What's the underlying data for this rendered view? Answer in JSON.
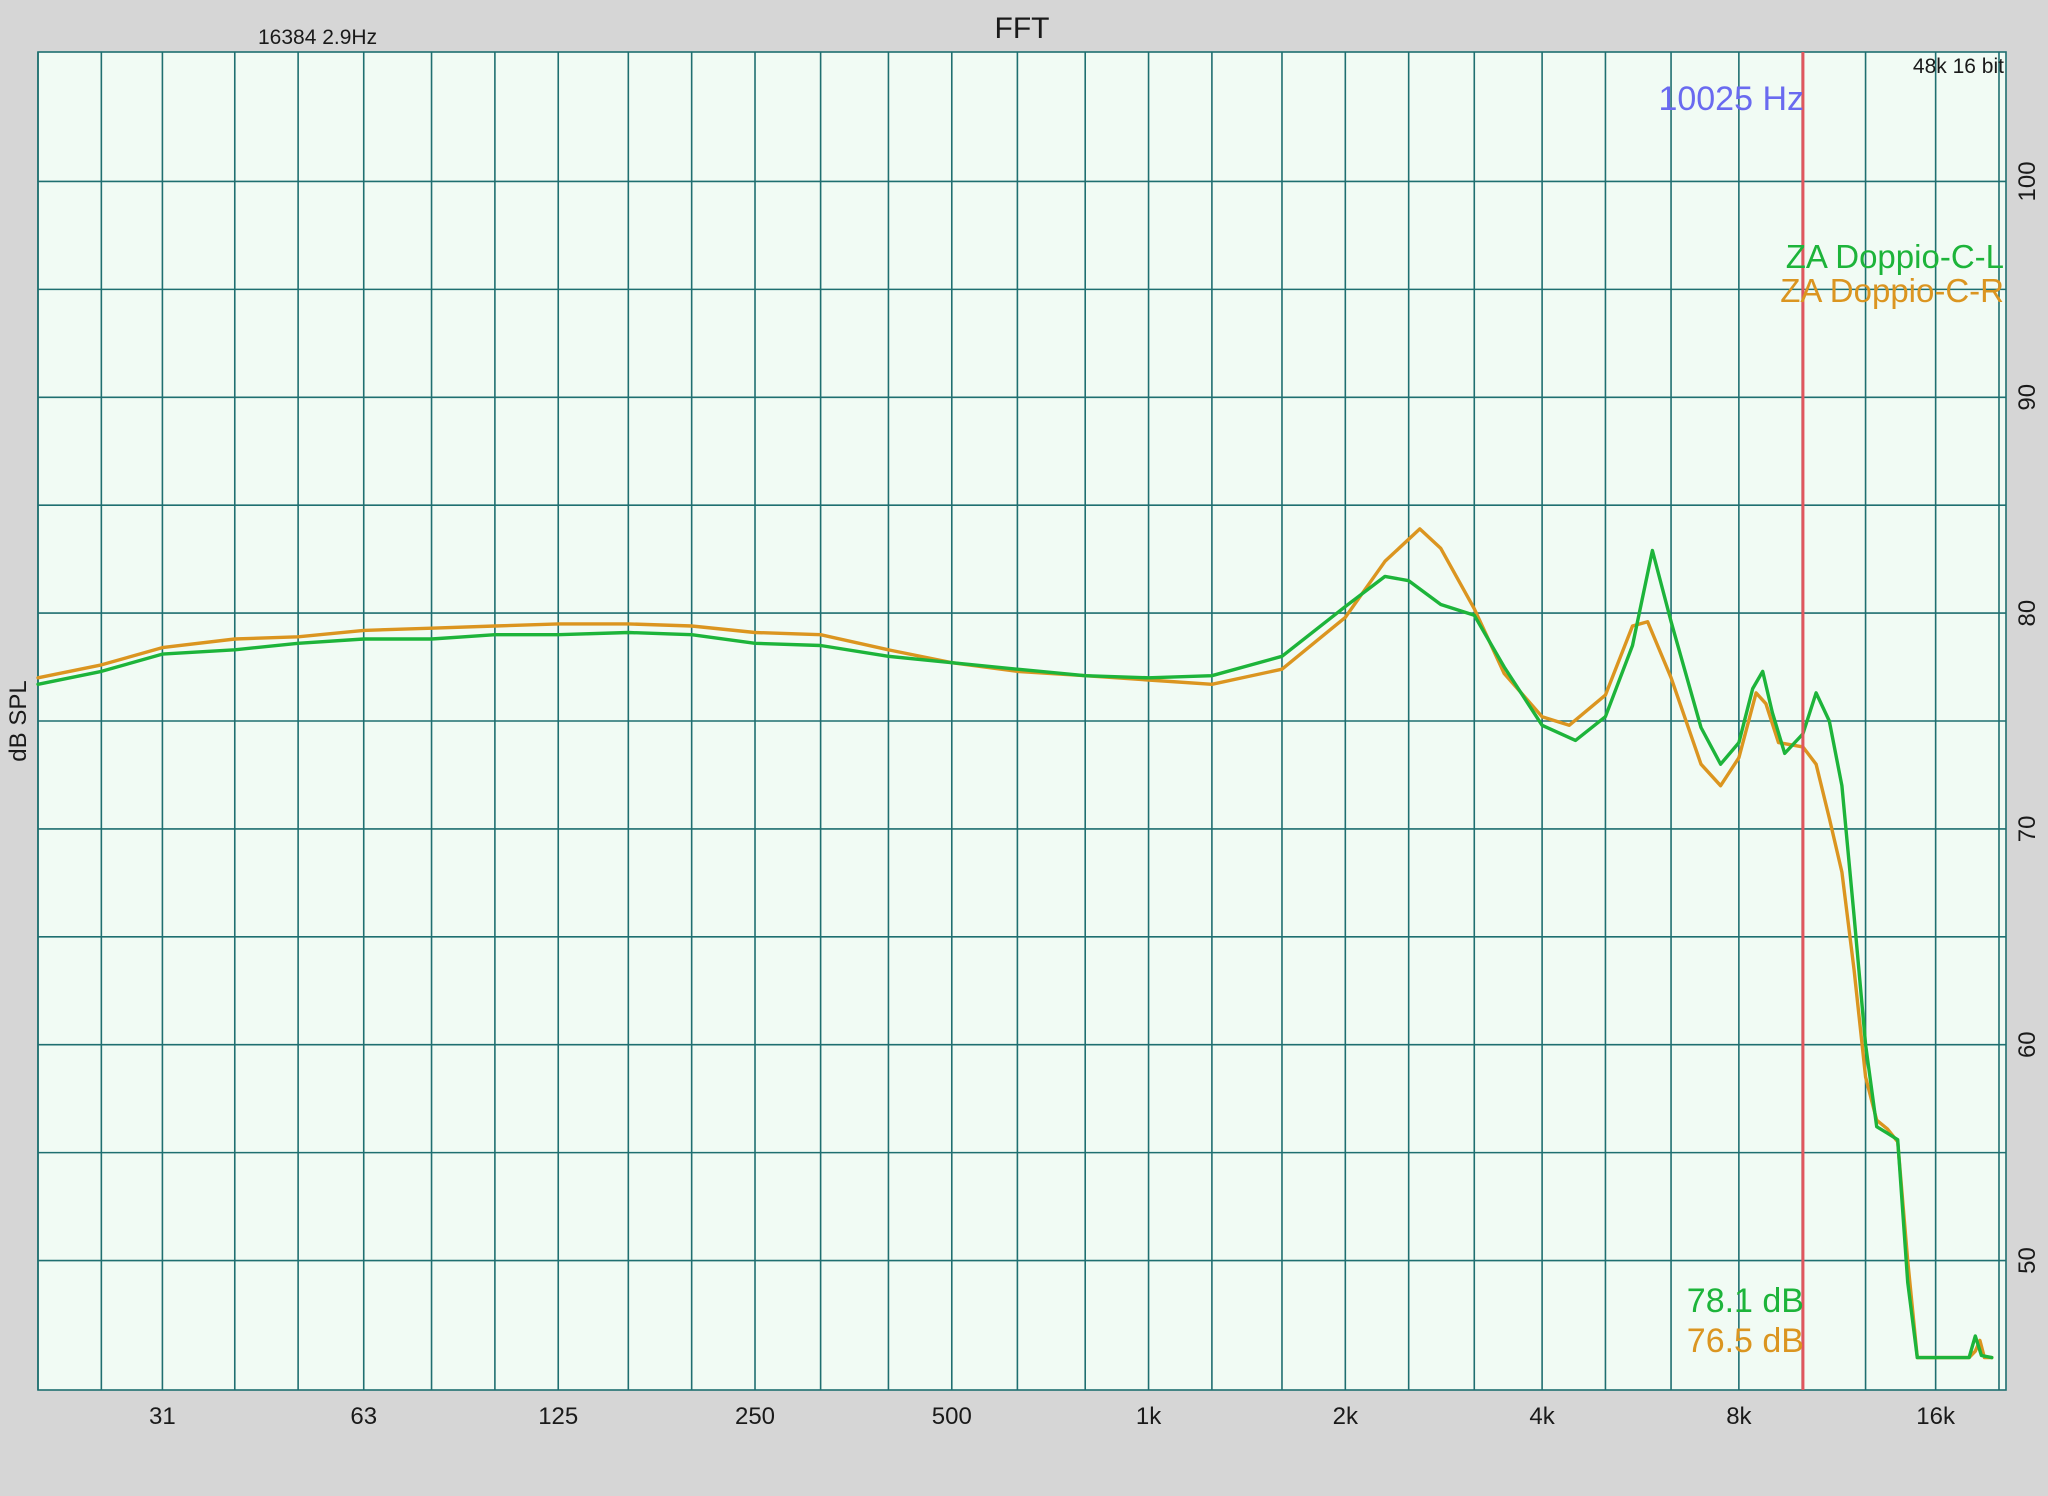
{
  "header": {
    "title": "FFT",
    "fft_info": "16384  2.9Hz",
    "format_info": "48k 16 bit"
  },
  "cursor": {
    "freq_label": "10025 Hz",
    "freq_hz": 10025,
    "readouts": [
      "78.1 dB",
      "76.5 dB"
    ]
  },
  "colors": {
    "plot_bg": "#f1fbf4",
    "frame_bg": "#d6d6d6",
    "grid": "#1f6f70",
    "cursor": "#e0565e",
    "cursor_label": "#6a6af0",
    "series_left": "#1db43a",
    "series_right": "#db9520"
  },
  "chart_data": {
    "type": "line",
    "title": "FFT",
    "xlabel": "",
    "ylabel": "dB SPL",
    "x_scale": "log",
    "xlim": [
      20,
      20500
    ],
    "ylim": [
      44,
      106
    ],
    "x_ticks": [
      {
        "value": 31,
        "label": "31"
      },
      {
        "value": 63,
        "label": "63"
      },
      {
        "value": 125,
        "label": "125"
      },
      {
        "value": 250,
        "label": "250"
      },
      {
        "value": 500,
        "label": "500"
      },
      {
        "value": 1000,
        "label": "1k"
      },
      {
        "value": 2000,
        "label": "2k"
      },
      {
        "value": 4000,
        "label": "4k"
      },
      {
        "value": 8000,
        "label": "8k"
      },
      {
        "value": 16000,
        "label": "16k"
      }
    ],
    "y_ticks": [
      {
        "value": 100,
        "label": "100"
      },
      {
        "value": 90,
        "label": "90"
      },
      {
        "value": 80,
        "label": "80"
      },
      {
        "value": 70,
        "label": "70"
      },
      {
        "value": 60,
        "label": "60"
      },
      {
        "value": 50,
        "label": "50"
      }
    ],
    "x_gridlines": [
      20,
      25,
      31,
      40,
      50,
      63,
      80,
      100,
      125,
      160,
      200,
      250,
      315,
      400,
      500,
      630,
      800,
      1000,
      1250,
      1600,
      2000,
      2500,
      3150,
      4000,
      5000,
      6300,
      8000,
      10000,
      12500,
      16000,
      20000
    ],
    "y_gridlines": [
      50,
      55,
      60,
      65,
      70,
      75,
      80,
      85,
      90,
      95,
      100
    ],
    "grid": true,
    "legend_position": "top-right",
    "series": [
      {
        "name": "ZA Doppio-C-L",
        "color": "#1db43a",
        "points": [
          [
            20,
            76.7
          ],
          [
            25,
            77.3
          ],
          [
            31,
            78.1
          ],
          [
            40,
            78.3
          ],
          [
            50,
            78.6
          ],
          [
            63,
            78.8
          ],
          [
            80,
            78.8
          ],
          [
            100,
            79.0
          ],
          [
            125,
            79.0
          ],
          [
            160,
            79.1
          ],
          [
            200,
            79.0
          ],
          [
            250,
            78.6
          ],
          [
            315,
            78.5
          ],
          [
            400,
            78.0
          ],
          [
            500,
            77.7
          ],
          [
            630,
            77.4
          ],
          [
            800,
            77.1
          ],
          [
            1000,
            77.0
          ],
          [
            1250,
            77.1
          ],
          [
            1600,
            78.0
          ],
          [
            2000,
            80.3
          ],
          [
            2300,
            81.7
          ],
          [
            2500,
            81.5
          ],
          [
            2800,
            80.4
          ],
          [
            3150,
            79.9
          ],
          [
            3500,
            77.5
          ],
          [
            4000,
            74.8
          ],
          [
            4500,
            74.1
          ],
          [
            5000,
            75.2
          ],
          [
            5500,
            78.5
          ],
          [
            5900,
            82.9
          ],
          [
            6300,
            79.6
          ],
          [
            7000,
            74.7
          ],
          [
            7500,
            73.0
          ],
          [
            8000,
            74.0
          ],
          [
            8400,
            76.5
          ],
          [
            8700,
            77.3
          ],
          [
            9000,
            75.4
          ],
          [
            9400,
            73.5
          ],
          [
            10025,
            74.4
          ],
          [
            10500,
            76.3
          ],
          [
            11000,
            75.0
          ],
          [
            11500,
            72.0
          ],
          [
            12000,
            66.0
          ],
          [
            12500,
            60.0
          ],
          [
            13000,
            56.2
          ],
          [
            13500,
            55.9
          ],
          [
            14000,
            55.6
          ],
          [
            14500,
            49.0
          ],
          [
            15000,
            45.5
          ],
          [
            16000,
            45.5
          ],
          [
            18000,
            45.5
          ],
          [
            18400,
            46.5
          ],
          [
            18800,
            45.6
          ],
          [
            19500,
            45.5
          ]
        ]
      },
      {
        "name": "ZA Doppio-C-R",
        "color": "#db9520",
        "points": [
          [
            20,
            77.0
          ],
          [
            25,
            77.6
          ],
          [
            31,
            78.4
          ],
          [
            40,
            78.8
          ],
          [
            50,
            78.9
          ],
          [
            63,
            79.2
          ],
          [
            80,
            79.3
          ],
          [
            100,
            79.4
          ],
          [
            125,
            79.5
          ],
          [
            160,
            79.5
          ],
          [
            200,
            79.4
          ],
          [
            250,
            79.1
          ],
          [
            315,
            79.0
          ],
          [
            400,
            78.3
          ],
          [
            500,
            77.7
          ],
          [
            630,
            77.3
          ],
          [
            800,
            77.1
          ],
          [
            1000,
            76.9
          ],
          [
            1250,
            76.7
          ],
          [
            1600,
            77.4
          ],
          [
            2000,
            79.8
          ],
          [
            2300,
            82.4
          ],
          [
            2600,
            83.9
          ],
          [
            2800,
            83.0
          ],
          [
            3150,
            80.2
          ],
          [
            3500,
            77.2
          ],
          [
            4000,
            75.2
          ],
          [
            4400,
            74.8
          ],
          [
            5000,
            76.2
          ],
          [
            5500,
            79.4
          ],
          [
            5800,
            79.6
          ],
          [
            6300,
            77.0
          ],
          [
            7000,
            73.0
          ],
          [
            7500,
            72.0
          ],
          [
            8000,
            73.3
          ],
          [
            8500,
            76.3
          ],
          [
            8800,
            75.8
          ],
          [
            9200,
            74.0
          ],
          [
            10025,
            73.8
          ],
          [
            10500,
            73.0
          ],
          [
            11000,
            70.5
          ],
          [
            11500,
            68.0
          ],
          [
            12000,
            63.5
          ],
          [
            12500,
            58.5
          ],
          [
            13000,
            56.5
          ],
          [
            13500,
            56.1
          ],
          [
            14000,
            55.5
          ],
          [
            14500,
            50.0
          ],
          [
            15000,
            45.5
          ],
          [
            16000,
            45.5
          ],
          [
            18000,
            45.5
          ],
          [
            18400,
            45.8
          ],
          [
            18700,
            46.3
          ],
          [
            19000,
            45.5
          ],
          [
            19500,
            45.5
          ]
        ]
      }
    ]
  }
}
